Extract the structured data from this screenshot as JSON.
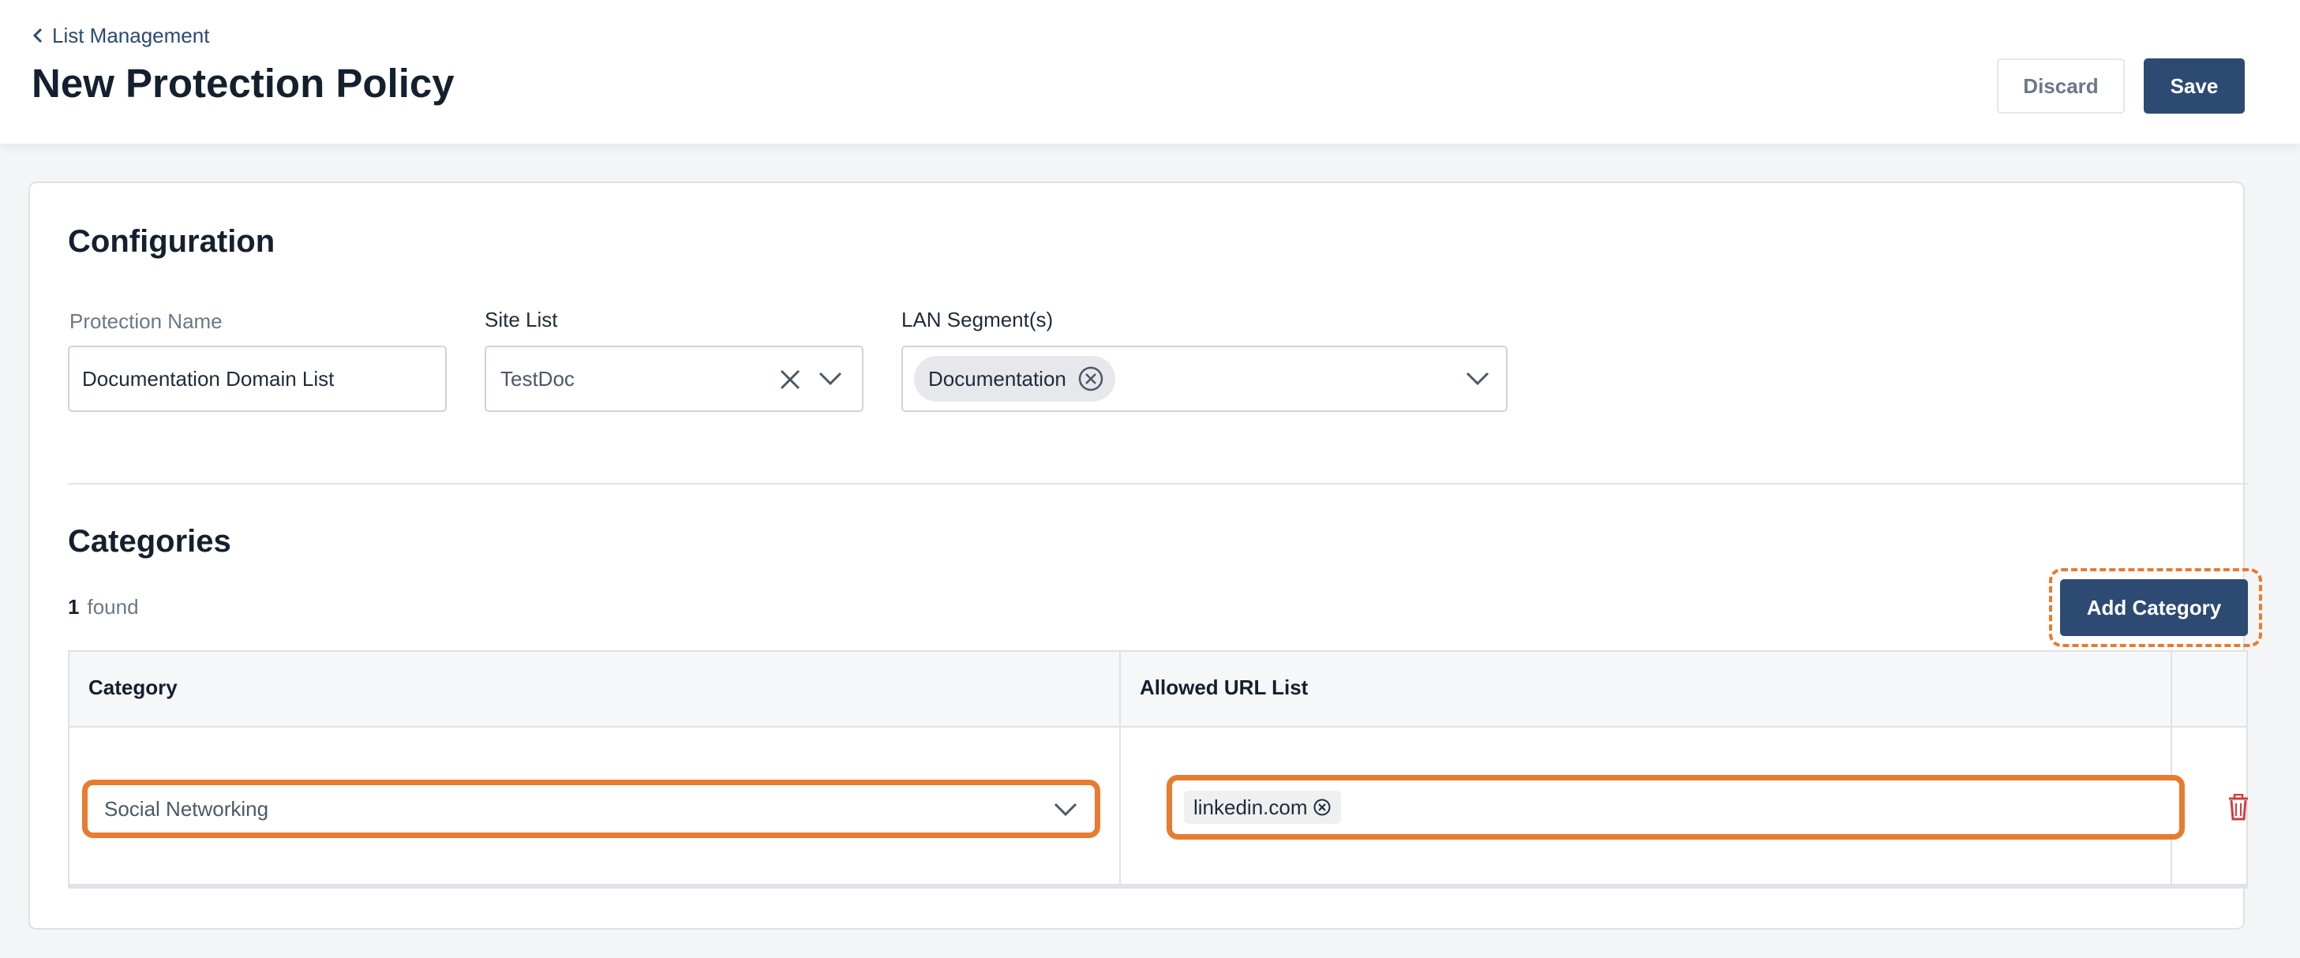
{
  "header": {
    "breadcrumb": "List Management",
    "title": "New Protection Policy",
    "discard_label": "Discard",
    "save_label": "Save"
  },
  "configuration": {
    "title": "Configuration",
    "protection_name": {
      "label": "Protection Name",
      "value": "Documentation Domain List"
    },
    "site_list": {
      "label": "Site List",
      "value": "TestDoc"
    },
    "lan_segments": {
      "label": "LAN Segment(s)",
      "chips": [
        "Documentation"
      ]
    }
  },
  "categories": {
    "title": "Categories",
    "found_count": "1",
    "found_label": "found",
    "add_label": "Add Category",
    "columns": [
      "Category",
      "Allowed URL List"
    ],
    "rows": [
      {
        "category": "Social Networking",
        "urls": [
          "linkedin.com"
        ]
      }
    ]
  },
  "colors": {
    "primary": "#2d4b72",
    "highlight": "#e87b2f",
    "danger": "#d63b3b"
  },
  "icons": [
    "chevron-left-icon",
    "clear-x-icon",
    "chevron-down-icon",
    "remove-circle-icon",
    "trash-icon"
  ]
}
